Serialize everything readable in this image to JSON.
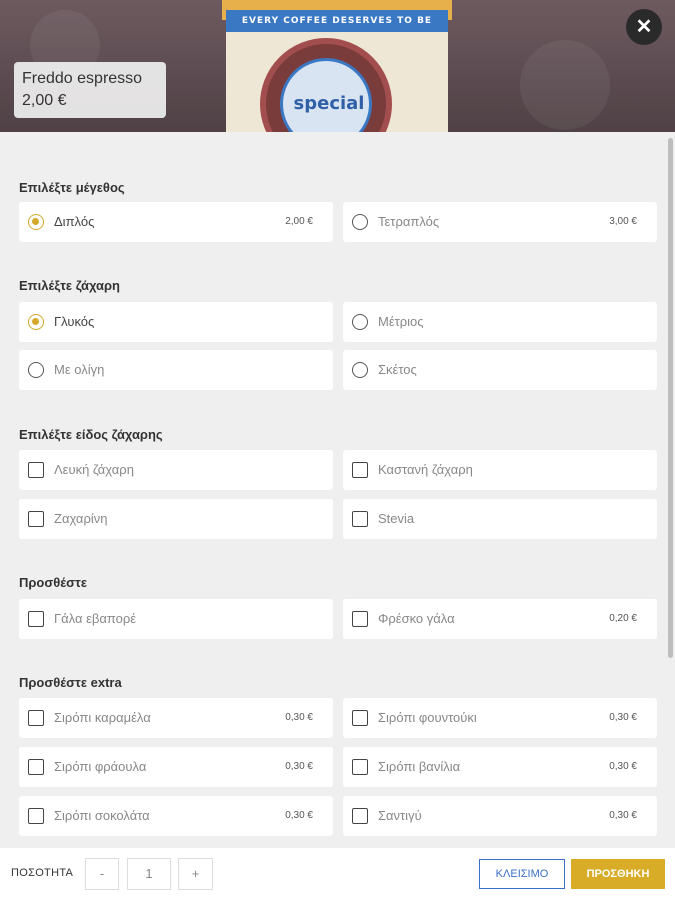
{
  "product": {
    "name": "Freddo espresso",
    "price": "2,00 €",
    "cup_band_text": "EVERY COFFEE DESERVES TO BE SPECIAL",
    "cup_logo_text": "special"
  },
  "close_icon": "close-icon",
  "sections": {
    "size": {
      "title": "Επιλέξτε μέγεθος",
      "options": [
        {
          "label": "Διπλός",
          "price": "2,00 €",
          "selected": true
        },
        {
          "label": "Τετραπλός",
          "price": "3,00 €",
          "selected": false
        }
      ]
    },
    "sugar": {
      "title": "Επιλέξτε ζάχαρη",
      "options": [
        {
          "label": "Γλυκός",
          "selected": true
        },
        {
          "label": "Μέτριος",
          "selected": false
        },
        {
          "label": "Με ολίγη",
          "selected": false
        },
        {
          "label": "Σκέτος",
          "selected": false
        }
      ]
    },
    "sugar_type": {
      "title": "Επιλέξτε είδος ζάχαρης",
      "options": [
        {
          "label": "Λευκή ζάχαρη"
        },
        {
          "label": "Καστανή ζάχαρη"
        },
        {
          "label": "Ζαχαρίνη"
        },
        {
          "label": "Stevia"
        }
      ]
    },
    "add": {
      "title": "Προσθέστε",
      "options": [
        {
          "label": "Γάλα εβαπορέ"
        },
        {
          "label": "Φρέσκο γάλα",
          "price": "0,20 €"
        }
      ]
    },
    "extra": {
      "title": "Προσθέστε extra",
      "options": [
        {
          "label": "Σιρόπι καραμέλα",
          "price": "0,30 €"
        },
        {
          "label": "Σιρόπι φουντούκι",
          "price": "0,30 €"
        },
        {
          "label": "Σιρόπι φράουλα",
          "price": "0,30 €"
        },
        {
          "label": "Σιρόπι βανίλια",
          "price": "0,30 €"
        },
        {
          "label": "Σιρόπι σοκολάτα",
          "price": "0,30 €"
        },
        {
          "label": "Σαντιγύ",
          "price": "0,30 €"
        }
      ]
    }
  },
  "footer": {
    "quantity_label": "ΠΟΣΟΤΗΤΑ",
    "minus": "-",
    "quantity": "1",
    "plus": "+",
    "close_label": "ΚΛΕΙΣΙΜΟ",
    "add_label": "ΠΡΟΣΘΗΚΗ"
  },
  "colors": {
    "accent": "#d9ac27",
    "link": "#3a6fc4"
  }
}
